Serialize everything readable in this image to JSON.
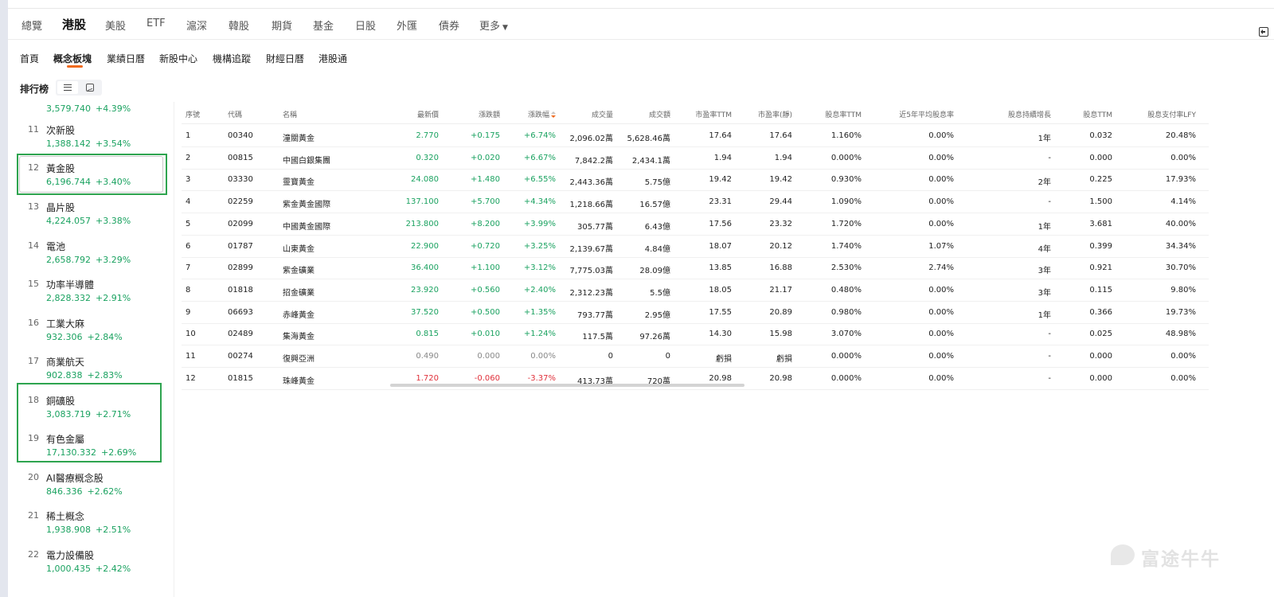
{
  "top_tabs": [
    "總覽",
    "港股",
    "美股",
    "ETF",
    "滬深",
    "韓股",
    "期貨",
    "基金",
    "日股",
    "外匯",
    "債券",
    "更多"
  ],
  "top_tab_active": "港股",
  "sub_tabs": [
    "首頁",
    "概念板塊",
    "業績日曆",
    "新股中心",
    "機構追蹤",
    "財經日曆",
    "港股通"
  ],
  "sub_tab_active": "概念板塊",
  "ranking_title": "排行榜",
  "left_list": {
    "partial_top": {
      "value": "3,579.740",
      "change": "+4.39%"
    },
    "items": [
      {
        "rank": "11",
        "name": "次新股",
        "value": "1,388.142",
        "change": "+3.54%"
      },
      {
        "rank": "12",
        "name": "黃金股",
        "value": "6,196.744",
        "change": "+3.40%"
      },
      {
        "rank": "13",
        "name": "晶片股",
        "value": "4,224.057",
        "change": "+3.38%"
      },
      {
        "rank": "14",
        "name": "電池",
        "value": "2,658.792",
        "change": "+3.29%"
      },
      {
        "rank": "15",
        "name": "功率半導體",
        "value": "2,828.332",
        "change": "+2.91%"
      },
      {
        "rank": "16",
        "name": "工業大麻",
        "value": "932.306",
        "change": "+2.84%"
      },
      {
        "rank": "17",
        "name": "商業航天",
        "value": "902.838",
        "change": "+2.83%"
      },
      {
        "rank": "18",
        "name": "銅礦股",
        "value": "3,083.719",
        "change": "+2.71%"
      },
      {
        "rank": "19",
        "name": "有色金屬",
        "value": "17,130.332",
        "change": "+2.69%"
      },
      {
        "rank": "20",
        "name": "AI醫療概念股",
        "value": "846.336",
        "change": "+2.62%"
      },
      {
        "rank": "21",
        "name": "稀土概念",
        "value": "1,938.908",
        "change": "+2.51%"
      },
      {
        "rank": "22",
        "name": "電力設備股",
        "value": "1,000.435",
        "change": "+2.42%"
      }
    ]
  },
  "table": {
    "headers": [
      "序號",
      "代碼",
      "名稱",
      "最新價",
      "漲跌額",
      "漲跌幅",
      "成交量",
      "成交額",
      "市盈率TTM",
      "市盈率(靜)",
      "股息率TTM",
      "近5年平均股息率",
      "股息持續增長",
      "股息TTM",
      "股息支付率LFY"
    ],
    "rows": [
      [
        "1",
        "00340",
        "潼關黃金",
        "2.770",
        "+0.175",
        "+6.74%",
        "2,096.02萬",
        "5,628.46萬",
        "17.64",
        "17.64",
        "1.160%",
        "0.00%",
        "1年",
        "0.032",
        "20.48%"
      ],
      [
        "2",
        "00815",
        "中國白銀集團",
        "0.320",
        "+0.020",
        "+6.67%",
        "7,842.2萬",
        "2,434.1萬",
        "1.94",
        "1.94",
        "0.000%",
        "0.00%",
        "-",
        "0.000",
        "0.00%"
      ],
      [
        "3",
        "03330",
        "靈寶黃金",
        "24.080",
        "+1.480",
        "+6.55%",
        "2,443.36萬",
        "5.75億",
        "19.42",
        "19.42",
        "0.930%",
        "0.00%",
        "2年",
        "0.225",
        "17.93%"
      ],
      [
        "4",
        "02259",
        "紫金黃金國際",
        "137.100",
        "+5.700",
        "+4.34%",
        "1,218.66萬",
        "16.57億",
        "23.31",
        "29.44",
        "1.090%",
        "0.00%",
        "-",
        "1.500",
        "4.14%"
      ],
      [
        "5",
        "02099",
        "中國黃金國際",
        "213.800",
        "+8.200",
        "+3.99%",
        "305.77萬",
        "6.43億",
        "17.56",
        "23.32",
        "1.720%",
        "0.00%",
        "1年",
        "3.681",
        "40.00%"
      ],
      [
        "6",
        "01787",
        "山東黃金",
        "22.900",
        "+0.720",
        "+3.25%",
        "2,139.67萬",
        "4.84億",
        "18.07",
        "20.12",
        "1.740%",
        "1.07%",
        "4年",
        "0.399",
        "34.34%"
      ],
      [
        "7",
        "02899",
        "紫金礦業",
        "36.400",
        "+1.100",
        "+3.12%",
        "7,775.03萬",
        "28.09億",
        "13.85",
        "16.88",
        "2.530%",
        "2.74%",
        "3年",
        "0.921",
        "30.70%"
      ],
      [
        "8",
        "01818",
        "招金礦業",
        "23.920",
        "+0.560",
        "+2.40%",
        "2,312.23萬",
        "5.5億",
        "18.05",
        "21.17",
        "0.480%",
        "0.00%",
        "3年",
        "0.115",
        "9.80%"
      ],
      [
        "9",
        "06693",
        "赤峰黃金",
        "37.520",
        "+0.500",
        "+1.35%",
        "793.77萬",
        "2.95億",
        "17.55",
        "20.89",
        "0.980%",
        "0.00%",
        "1年",
        "0.366",
        "19.73%"
      ],
      [
        "10",
        "02489",
        "集海黃金",
        "0.815",
        "+0.010",
        "+1.24%",
        "117.5萬",
        "97.26萬",
        "14.30",
        "15.98",
        "3.070%",
        "0.00%",
        "-",
        "0.025",
        "48.98%"
      ],
      [
        "11",
        "00274",
        "復興亞洲",
        "0.490",
        "0.000",
        "0.00%",
        "0",
        "0",
        "虧損",
        "虧損",
        "0.000%",
        "0.00%",
        "-",
        "0.000",
        "0.00%"
      ],
      [
        "12",
        "01815",
        "珠峰黃金",
        "1.720",
        "-0.060",
        "-3.37%",
        "413.73萬",
        "720萬",
        "20.98",
        "20.98",
        "0.000%",
        "0.00%",
        "-",
        "0.000",
        "0.00%"
      ]
    ]
  },
  "watermark": "富途牛牛",
  "colors": {
    "up": "#1aa260",
    "down": "#e0303a",
    "accent": "#f06a1d",
    "highlight": "#2ea44f"
  }
}
